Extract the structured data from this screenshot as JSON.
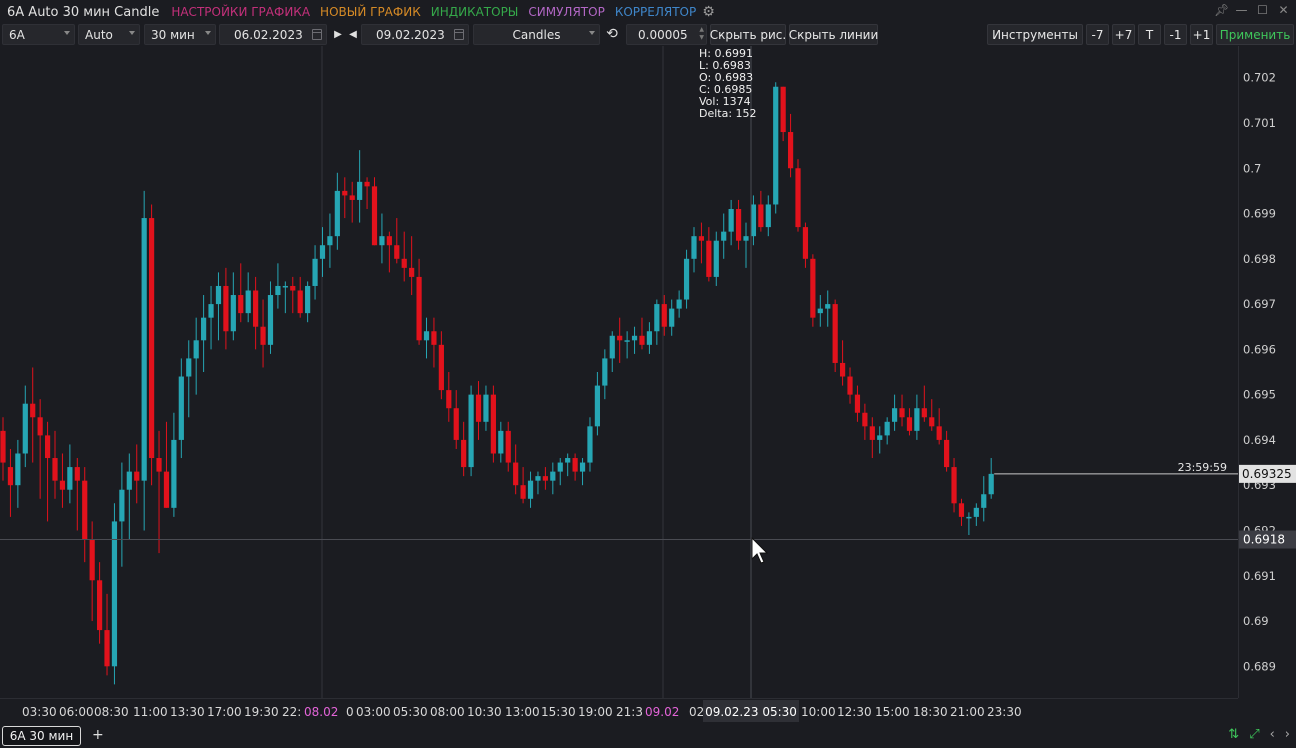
{
  "title_bar": {
    "title": "6A Auto 30 мин Candle",
    "menu": [
      {
        "label": "НАСТРОЙКИ ГРАФИКА",
        "color": "#c2307a"
      },
      {
        "label": "НОВЫЙ ГРАФИК",
        "color": "#d58a26"
      },
      {
        "label": "ИНДИКАТОРЫ",
        "color": "#35a84a"
      },
      {
        "label": "СИМУЛЯТОР",
        "color": "#b267c5"
      },
      {
        "label": "КОРРЕЛЯТОР",
        "color": "#3f86c9"
      }
    ],
    "icons": [
      "gear-icon",
      "pin-icon",
      "minimize-icon",
      "maximize-icon",
      "close-icon"
    ]
  },
  "toolbar": {
    "symbol": "6A",
    "mode": "Auto",
    "timeframe": "30 мин",
    "date_from": "06.02.2023",
    "date_to": "09.02.2023",
    "chart_type": "Candles",
    "tick_size": "0.00005",
    "hide_drawings": "Скрыть рис.",
    "hide_lines": "Скрыть линии",
    "instruments": "Инструменты",
    "minus7": "-7",
    "plus7": "+7",
    "t": "T",
    "minus1": "-1",
    "plus1": "+1",
    "apply": "Применить"
  },
  "ohlc": {
    "h": "H: 0.6991",
    "l": "L: 0.6983",
    "o": "O: 0.6983",
    "c": "C: 0.6985",
    "vol": "Vol: 1374",
    "delta": "Delta: 152"
  },
  "colors": {
    "bull": "#26a6b4",
    "bear": "#e2121c",
    "background": "#1b1c21",
    "grid": "#2c2d33"
  },
  "chart_data": {
    "type": "candlestick",
    "y_ticks": [
      "0.702",
      "0.701",
      "0.7",
      "0.699",
      "0.698",
      "0.697",
      "0.696",
      "0.695",
      "0.694",
      "0.693",
      "0.692",
      "0.691",
      "0.69",
      "0.689"
    ],
    "ylim": [
      0.6883,
      0.7027
    ],
    "x_ticks": [
      "03:30",
      "06:00",
      "08:30",
      "11:00",
      "13:30",
      "17:00",
      "19:30",
      "22:",
      "08.02",
      "0",
      "03:00",
      "05:30",
      "08:00",
      "10:30",
      "13:00",
      "15:30",
      "19:00",
      "21:3",
      "09.02",
      "02",
      "10:00",
      "12:30",
      "15:00",
      "18:30",
      "21:00",
      "23:30"
    ],
    "day_separators": [
      "08.02",
      "09.02"
    ],
    "current_price": "0.69325",
    "countdown": "23:59:59",
    "crosshair_price": "0.6918",
    "crosshair_time": "09.02.23 05:30",
    "candles": [
      [
        0.6942,
        0.6945,
        0.6931,
        0.6935
      ],
      [
        0.6934,
        0.6938,
        0.6923,
        0.693
      ],
      [
        0.693,
        0.694,
        0.6925,
        0.6937
      ],
      [
        0.6937,
        0.6952,
        0.6934,
        0.6948
      ],
      [
        0.6948,
        0.6956,
        0.6935,
        0.6945
      ],
      [
        0.6945,
        0.6949,
        0.6927,
        0.6941
      ],
      [
        0.6941,
        0.6944,
        0.6922,
        0.6936
      ],
      [
        0.6936,
        0.6942,
        0.6927,
        0.6931
      ],
      [
        0.6931,
        0.6937,
        0.6925,
        0.6929
      ],
      [
        0.6929,
        0.6939,
        0.6926,
        0.6934
      ],
      [
        0.6934,
        0.6936,
        0.692,
        0.6931
      ],
      [
        0.6931,
        0.6934,
        0.6913,
        0.6918
      ],
      [
        0.6918,
        0.6922,
        0.69,
        0.6909
      ],
      [
        0.6909,
        0.6913,
        0.6895,
        0.6898
      ],
      [
        0.6898,
        0.6906,
        0.6888,
        0.689
      ],
      [
        0.689,
        0.6926,
        0.6886,
        0.6922
      ],
      [
        0.6922,
        0.6935,
        0.6912,
        0.6929
      ],
      [
        0.6929,
        0.6937,
        0.6918,
        0.6933
      ],
      [
        0.6933,
        0.6939,
        0.6926,
        0.6931
      ],
      [
        0.6931,
        0.6995,
        0.692,
        0.6989
      ],
      [
        0.6989,
        0.6992,
        0.693,
        0.6936
      ],
      [
        0.6936,
        0.6942,
        0.6915,
        0.6933
      ],
      [
        0.6933,
        0.6944,
        0.6925,
        0.6925
      ],
      [
        0.6925,
        0.6946,
        0.6923,
        0.694
      ],
      [
        0.694,
        0.6958,
        0.6936,
        0.6954
      ],
      [
        0.6954,
        0.6962,
        0.6945,
        0.6958
      ],
      [
        0.6958,
        0.6967,
        0.695,
        0.6962
      ],
      [
        0.6962,
        0.6972,
        0.6955,
        0.6967
      ],
      [
        0.6967,
        0.6974,
        0.696,
        0.697
      ],
      [
        0.697,
        0.6977,
        0.6962,
        0.6974
      ],
      [
        0.6974,
        0.6978,
        0.696,
        0.6964
      ],
      [
        0.6964,
        0.6977,
        0.6962,
        0.6972
      ],
      [
        0.6972,
        0.6979,
        0.6966,
        0.6968
      ],
      [
        0.6968,
        0.6977,
        0.6966,
        0.6973
      ],
      [
        0.6973,
        0.6976,
        0.696,
        0.6965
      ],
      [
        0.6965,
        0.6971,
        0.6956,
        0.6961
      ],
      [
        0.6961,
        0.6975,
        0.6959,
        0.6972
      ],
      [
        0.6972,
        0.6979,
        0.6969,
        0.6974
      ],
      [
        0.6974,
        0.6975,
        0.6968,
        0.6974
      ],
      [
        0.6974,
        0.6976,
        0.6968,
        0.6973
      ],
      [
        0.6973,
        0.6976,
        0.6967,
        0.6968
      ],
      [
        0.6968,
        0.6975,
        0.6966,
        0.6974
      ],
      [
        0.6974,
        0.6983,
        0.6971,
        0.698
      ],
      [
        0.698,
        0.6987,
        0.6976,
        0.6983
      ],
      [
        0.6983,
        0.699,
        0.6978,
        0.6985
      ],
      [
        0.6985,
        0.6999,
        0.6982,
        0.6995
      ],
      [
        0.6995,
        0.6998,
        0.6989,
        0.6994
      ],
      [
        0.6994,
        0.6997,
        0.6988,
        0.6993
      ],
      [
        0.6993,
        0.7004,
        0.6988,
        0.6997
      ],
      [
        0.6997,
        0.6998,
        0.6991,
        0.6996
      ],
      [
        0.6996,
        0.6998,
        0.6983,
        0.6983
      ],
      [
        0.6983,
        0.699,
        0.6979,
        0.6985
      ],
      [
        0.6985,
        0.6986,
        0.6977,
        0.6983
      ],
      [
        0.6983,
        0.6989,
        0.6979,
        0.698
      ],
      [
        0.698,
        0.6986,
        0.6975,
        0.6978
      ],
      [
        0.6978,
        0.6985,
        0.6972,
        0.6976
      ],
      [
        0.6976,
        0.698,
        0.6961,
        0.6962
      ],
      [
        0.6962,
        0.6967,
        0.6958,
        0.6964
      ],
      [
        0.6964,
        0.6967,
        0.6956,
        0.6961
      ],
      [
        0.6961,
        0.6964,
        0.6949,
        0.6951
      ],
      [
        0.6951,
        0.6955,
        0.6944,
        0.6947
      ],
      [
        0.6947,
        0.6951,
        0.6938,
        0.694
      ],
      [
        0.694,
        0.6944,
        0.6932,
        0.6934
      ],
      [
        0.6934,
        0.6952,
        0.6932,
        0.695
      ],
      [
        0.695,
        0.6953,
        0.694,
        0.6944
      ],
      [
        0.6944,
        0.6952,
        0.6942,
        0.695
      ],
      [
        0.695,
        0.6952,
        0.6935,
        0.6937
      ],
      [
        0.6937,
        0.6944,
        0.6935,
        0.6942
      ],
      [
        0.6942,
        0.6944,
        0.6933,
        0.6935
      ],
      [
        0.6935,
        0.6939,
        0.6928,
        0.693
      ],
      [
        0.693,
        0.6934,
        0.6926,
        0.6927
      ],
      [
        0.6927,
        0.6933,
        0.6925,
        0.6931
      ],
      [
        0.6931,
        0.6933,
        0.6928,
        0.6932
      ],
      [
        0.6932,
        0.6934,
        0.6929,
        0.6931
      ],
      [
        0.6931,
        0.6935,
        0.6928,
        0.6933
      ],
      [
        0.6933,
        0.6936,
        0.693,
        0.6935
      ],
      [
        0.6935,
        0.6937,
        0.6932,
        0.6936
      ],
      [
        0.6936,
        0.6937,
        0.6931,
        0.6933
      ],
      [
        0.6933,
        0.6936,
        0.693,
        0.6935
      ],
      [
        0.6935,
        0.6945,
        0.6933,
        0.6943
      ],
      [
        0.6943,
        0.6955,
        0.6941,
        0.6952
      ],
      [
        0.6952,
        0.696,
        0.6949,
        0.6958
      ],
      [
        0.6958,
        0.6964,
        0.6955,
        0.6963
      ],
      [
        0.6963,
        0.6967,
        0.6957,
        0.6962
      ],
      [
        0.6962,
        0.6964,
        0.6958,
        0.6962
      ],
      [
        0.6962,
        0.6965,
        0.6959,
        0.6963
      ],
      [
        0.6963,
        0.6967,
        0.696,
        0.6961
      ],
      [
        0.6961,
        0.6966,
        0.6959,
        0.6964
      ],
      [
        0.6964,
        0.6971,
        0.6961,
        0.697
      ],
      [
        0.697,
        0.6972,
        0.6963,
        0.6965
      ],
      [
        0.6965,
        0.6971,
        0.6963,
        0.6969
      ],
      [
        0.6969,
        0.6973,
        0.6967,
        0.6971
      ],
      [
        0.6971,
        0.6982,
        0.6969,
        0.698
      ],
      [
        0.698,
        0.6987,
        0.6977,
        0.6985
      ],
      [
        0.6985,
        0.6988,
        0.6979,
        0.6984
      ],
      [
        0.6984,
        0.6987,
        0.6975,
        0.6976
      ],
      [
        0.6976,
        0.6986,
        0.6974,
        0.6984
      ],
      [
        0.6984,
        0.699,
        0.698,
        0.6986
      ],
      [
        0.6986,
        0.6993,
        0.6983,
        0.6991
      ],
      [
        0.6991,
        0.6993,
        0.6982,
        0.6984
      ],
      [
        0.6984,
        0.6988,
        0.6978,
        0.6985
      ],
      [
        0.6985,
        0.6994,
        0.6983,
        0.6992
      ],
      [
        0.6992,
        0.6995,
        0.6986,
        0.6987
      ],
      [
        0.6987,
        0.6994,
        0.6985,
        0.6992
      ],
      [
        0.6992,
        0.7019,
        0.699,
        0.7018
      ],
      [
        0.7018,
        0.7018,
        0.7006,
        0.7008
      ],
      [
        0.7008,
        0.7012,
        0.6998,
        0.7
      ],
      [
        0.7,
        0.7002,
        0.6986,
        0.6987
      ],
      [
        0.6987,
        0.6988,
        0.6978,
        0.698
      ],
      [
        0.698,
        0.6981,
        0.6965,
        0.6967
      ],
      [
        0.6968,
        0.6972,
        0.6965,
        0.6969
      ],
      [
        0.6969,
        0.6973,
        0.6965,
        0.697
      ],
      [
        0.697,
        0.6971,
        0.6955,
        0.6957
      ],
      [
        0.6957,
        0.6962,
        0.6952,
        0.6954
      ],
      [
        0.6954,
        0.6956,
        0.6948,
        0.695
      ],
      [
        0.695,
        0.6952,
        0.6944,
        0.6946
      ],
      [
        0.6946,
        0.6948,
        0.694,
        0.6943
      ],
      [
        0.6943,
        0.6945,
        0.6936,
        0.694
      ],
      [
        0.694,
        0.6943,
        0.6937,
        0.6941
      ],
      [
        0.6941,
        0.6945,
        0.6939,
        0.6944
      ],
      [
        0.6944,
        0.695,
        0.6942,
        0.6947
      ],
      [
        0.6947,
        0.695,
        0.6943,
        0.6945
      ],
      [
        0.6945,
        0.6947,
        0.6941,
        0.6942
      ],
      [
        0.6942,
        0.695,
        0.694,
        0.6947
      ],
      [
        0.6947,
        0.6952,
        0.6944,
        0.6945
      ],
      [
        0.6945,
        0.6949,
        0.6942,
        0.6943
      ],
      [
        0.6943,
        0.6947,
        0.6939,
        0.694
      ],
      [
        0.694,
        0.6942,
        0.6933,
        0.6934
      ],
      [
        0.6934,
        0.6936,
        0.6924,
        0.6926
      ],
      [
        0.6926,
        0.6927,
        0.6921,
        0.6923
      ],
      [
        0.6923,
        0.6924,
        0.6919,
        0.6923
      ],
      [
        0.6923,
        0.6926,
        0.6921,
        0.6925
      ],
      [
        0.6925,
        0.6932,
        0.6922,
        0.6928
      ],
      [
        0.6928,
        0.6936,
        0.6927,
        0.69325
      ]
    ]
  },
  "tabs": [
    {
      "label": "6A 30 мин"
    }
  ],
  "tab_add": "+"
}
